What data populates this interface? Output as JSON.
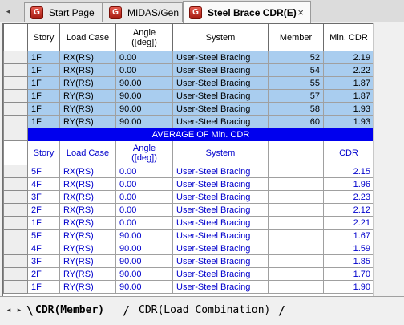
{
  "tabs": [
    {
      "label": "Start Page",
      "active": false
    },
    {
      "label": "MIDAS/Gen",
      "active": false
    },
    {
      "label": "Steel Brace CDR(E)",
      "active": true
    }
  ],
  "tab_icon_glyph": "G",
  "close_glyph": "×",
  "nav_glyphs": {
    "tabs_left": "◂",
    "first": "◂",
    "next": "▸"
  },
  "header": {
    "story": "Story",
    "load_case": "Load Case",
    "angle_line1": "Angle",
    "angle_line2": "([deg])",
    "system": "System",
    "member": "Member",
    "min_cdr": "Min. CDR"
  },
  "member_rows": [
    {
      "story": "1F",
      "load_case": "RX(RS)",
      "angle": "0.00",
      "system": "User-Steel Bracing",
      "member": "52",
      "cdr": "2.19"
    },
    {
      "story": "1F",
      "load_case": "RX(RS)",
      "angle": "0.00",
      "system": "User-Steel Bracing",
      "member": "54",
      "cdr": "2.22"
    },
    {
      "story": "1F",
      "load_case": "RY(RS)",
      "angle": "90.00",
      "system": "User-Steel Bracing",
      "member": "55",
      "cdr": "1.87"
    },
    {
      "story": "1F",
      "load_case": "RY(RS)",
      "angle": "90.00",
      "system": "User-Steel Bracing",
      "member": "57",
      "cdr": "1.87"
    },
    {
      "story": "1F",
      "load_case": "RY(RS)",
      "angle": "90.00",
      "system": "User-Steel Bracing",
      "member": "58",
      "cdr": "1.93"
    },
    {
      "story": "1F",
      "load_case": "RY(RS)",
      "angle": "90.00",
      "system": "User-Steel Bracing",
      "member": "60",
      "cdr": "1.93"
    }
  ],
  "average_banner": "AVERAGE OF Min. CDR",
  "avg_header": {
    "story": "Story",
    "load_case": "Load Case",
    "angle_line1": "Angle",
    "angle_line2": "([deg])",
    "system": "System",
    "member": "",
    "cdr": "CDR"
  },
  "average_rows": [
    {
      "story": "5F",
      "load_case": "RX(RS)",
      "angle": "0.00",
      "system": "User-Steel Bracing",
      "cdr": "2.15"
    },
    {
      "story": "4F",
      "load_case": "RX(RS)",
      "angle": "0.00",
      "system": "User-Steel Bracing",
      "cdr": "1.96"
    },
    {
      "story": "3F",
      "load_case": "RX(RS)",
      "angle": "0.00",
      "system": "User-Steel Bracing",
      "cdr": "2.23"
    },
    {
      "story": "2F",
      "load_case": "RX(RS)",
      "angle": "0.00",
      "system": "User-Steel Bracing",
      "cdr": "2.12"
    },
    {
      "story": "1F",
      "load_case": "RX(RS)",
      "angle": "0.00",
      "system": "User-Steel Bracing",
      "cdr": "2.21"
    },
    {
      "story": "5F",
      "load_case": "RY(RS)",
      "angle": "90.00",
      "system": "User-Steel Bracing",
      "cdr": "1.67"
    },
    {
      "story": "4F",
      "load_case": "RY(RS)",
      "angle": "90.00",
      "system": "User-Steel Bracing",
      "cdr": "1.59"
    },
    {
      "story": "3F",
      "load_case": "RY(RS)",
      "angle": "90.00",
      "system": "User-Steel Bracing",
      "cdr": "1.85"
    },
    {
      "story": "2F",
      "load_case": "RY(RS)",
      "angle": "90.00",
      "system": "User-Steel Bracing",
      "cdr": "1.70"
    },
    {
      "story": "1F",
      "load_case": "RY(RS)",
      "angle": "90.00",
      "system": "User-Steel Bracing",
      "cdr": "1.90"
    }
  ],
  "sheet_tabs": [
    {
      "label": "CDR(Member)",
      "active": true
    },
    {
      "label": "CDR(Load Combination)",
      "active": false
    }
  ],
  "sheet_separators": [
    "\\",
    "/",
    "/"
  ],
  "colors": {
    "selection": "#a9cdef",
    "banner_bg": "#0000ee",
    "banner_text": "#ffffff",
    "average_text": "#0000cc",
    "app_icon": "#c0281c"
  }
}
